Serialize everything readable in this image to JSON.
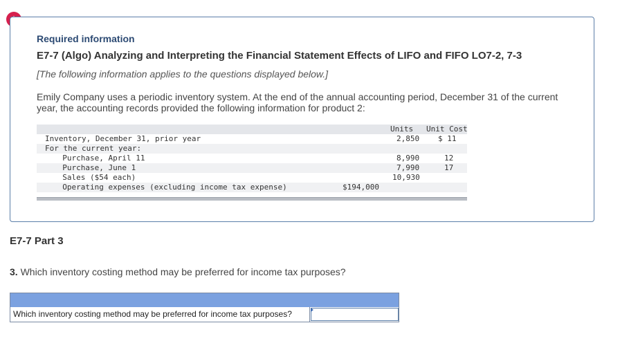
{
  "alert": {
    "glyph": "!",
    "icon": "exclamation-icon",
    "color": "#d6204e"
  },
  "info": {
    "heading": "Required information",
    "exercise_title": "E7-7 (Algo) Analyzing and Interpreting the Financial Statement Effects of LIFO and FIFO LO7-2, 7-3",
    "note": "[The following information applies to the questions displayed below.]",
    "description": "Emily Company uses a periodic inventory system. At the end of the annual accounting period, December 31 of the current year, the accounting records provided the following information for product 2:"
  },
  "table": {
    "col_units": "Units",
    "col_unit_cost": "Unit Cost",
    "rows": [
      {
        "label": "Inventory, December 31, prior year",
        "amount": "",
        "units": "2,850",
        "unit_cost": "$ 11"
      },
      {
        "label": "For the current year:",
        "amount": "",
        "units": "",
        "unit_cost": ""
      },
      {
        "label": "  Purchase, April 11",
        "amount": "",
        "units": "8,990",
        "unit_cost": "12"
      },
      {
        "label": "  Purchase, June 1",
        "amount": "",
        "units": "7,990",
        "unit_cost": "17"
      },
      {
        "label": "  Sales ($54 each)",
        "amount": "",
        "units": "10,930",
        "unit_cost": ""
      },
      {
        "label": "  Operating expenses (excluding income tax expense)",
        "amount": "$194,000",
        "units": "",
        "unit_cost": ""
      }
    ]
  },
  "part": {
    "title": "E7-7 Part 3"
  },
  "question": {
    "number": "3.",
    "text": "Which inventory costing method may be preferred for income tax purposes?"
  },
  "answer": {
    "label": "Which inventory costing method may be preferred for income tax purposes?",
    "value": "",
    "header_color": "#7ba1e0"
  }
}
